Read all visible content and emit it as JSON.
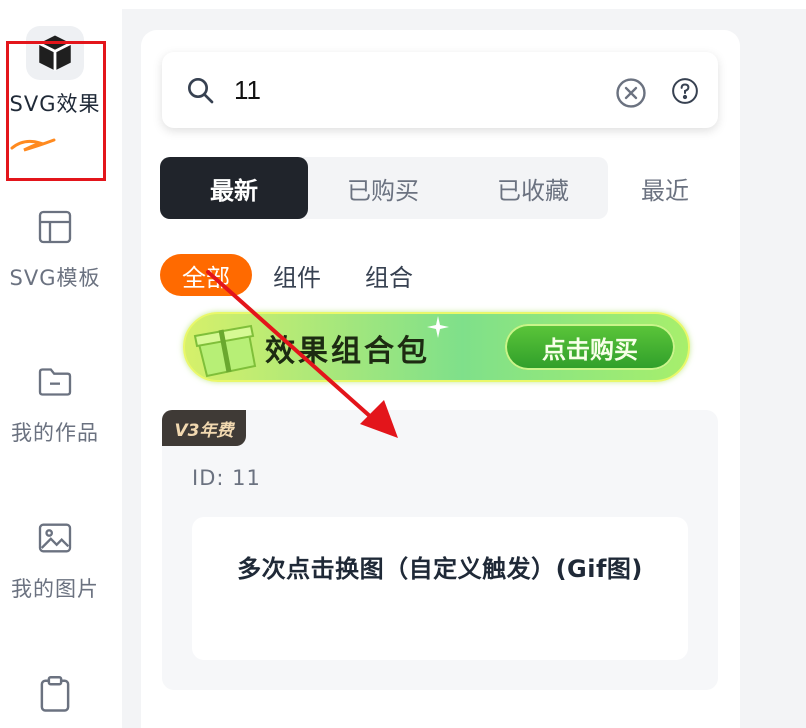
{
  "sidebar": {
    "items": [
      {
        "label": "SVG效果",
        "icon": "cube-icon",
        "active": true
      },
      {
        "label": "SVG模板",
        "icon": "layout-icon",
        "active": false
      },
      {
        "label": "我的作品",
        "icon": "folder-icon",
        "active": false
      },
      {
        "label": "我的图片",
        "icon": "image-icon",
        "active": false
      },
      {
        "label": "",
        "icon": "clipboard-icon",
        "active": false
      }
    ]
  },
  "search": {
    "value": "11",
    "icons": [
      "search-icon",
      "clear-icon",
      "help-icon"
    ]
  },
  "tabs": [
    {
      "label": "最新",
      "active": true
    },
    {
      "label": "已购买",
      "active": false
    },
    {
      "label": "已收藏",
      "active": false
    }
  ],
  "tab_recent": "最近",
  "filters": [
    {
      "label": "全部",
      "active": true
    },
    {
      "label": "组件",
      "active": false
    },
    {
      "label": "组合",
      "active": false
    }
  ],
  "banner": {
    "title": "效果组合包",
    "button": "点击购买"
  },
  "card": {
    "badge": "V3年费",
    "id_text": "ID: 11",
    "title": "多次点击换图（自定义触发）(Gif图)"
  },
  "colors": {
    "accent_orange": "#ff6a00",
    "tab_active_bg": "#20242b",
    "annotation_red": "#e3151b"
  }
}
